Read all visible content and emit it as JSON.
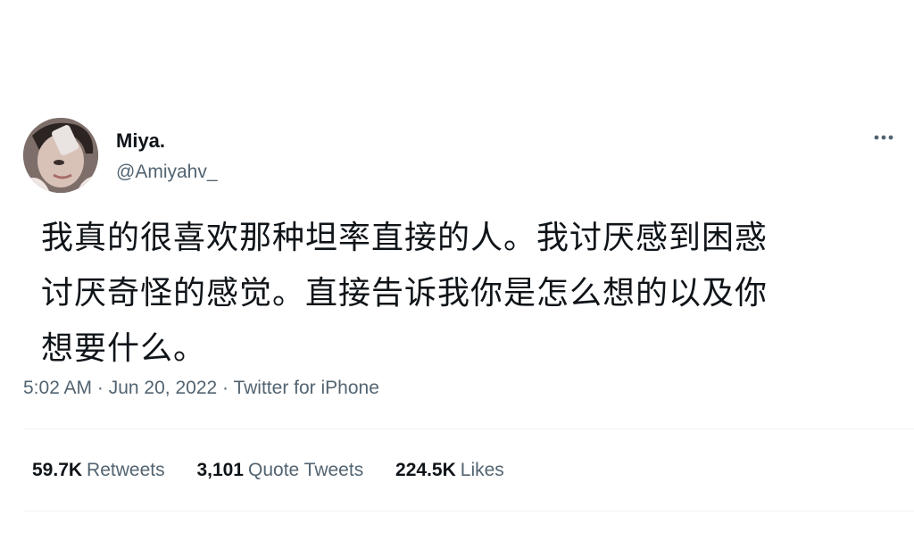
{
  "author": {
    "display_name": "Miya.",
    "handle": "@Amiyahv_"
  },
  "tweet": {
    "lines": [
      "我真的很喜欢那种坦率直接的人。我讨厌感到困惑",
      "讨厌奇怪的感觉。直接告诉我你是怎么想的以及你",
      "想要什么。"
    ],
    "time": "5:02 AM",
    "date": "Jun 20, 2022",
    "source": "Twitter for iPhone",
    "separator": "·"
  },
  "stats": {
    "retweets": {
      "count": "59.7K",
      "label": "Retweets"
    },
    "quote_tweets": {
      "count": "3,101",
      "label": "Quote Tweets"
    },
    "likes": {
      "count": "224.5K",
      "label": "Likes"
    }
  },
  "icons": {
    "more": "more-horizontal-icon",
    "avatar": "profile-photo"
  },
  "colors": {
    "text_primary": "#0f1419",
    "text_secondary": "#536471",
    "divider": "#eff3f4",
    "background": "#ffffff"
  }
}
